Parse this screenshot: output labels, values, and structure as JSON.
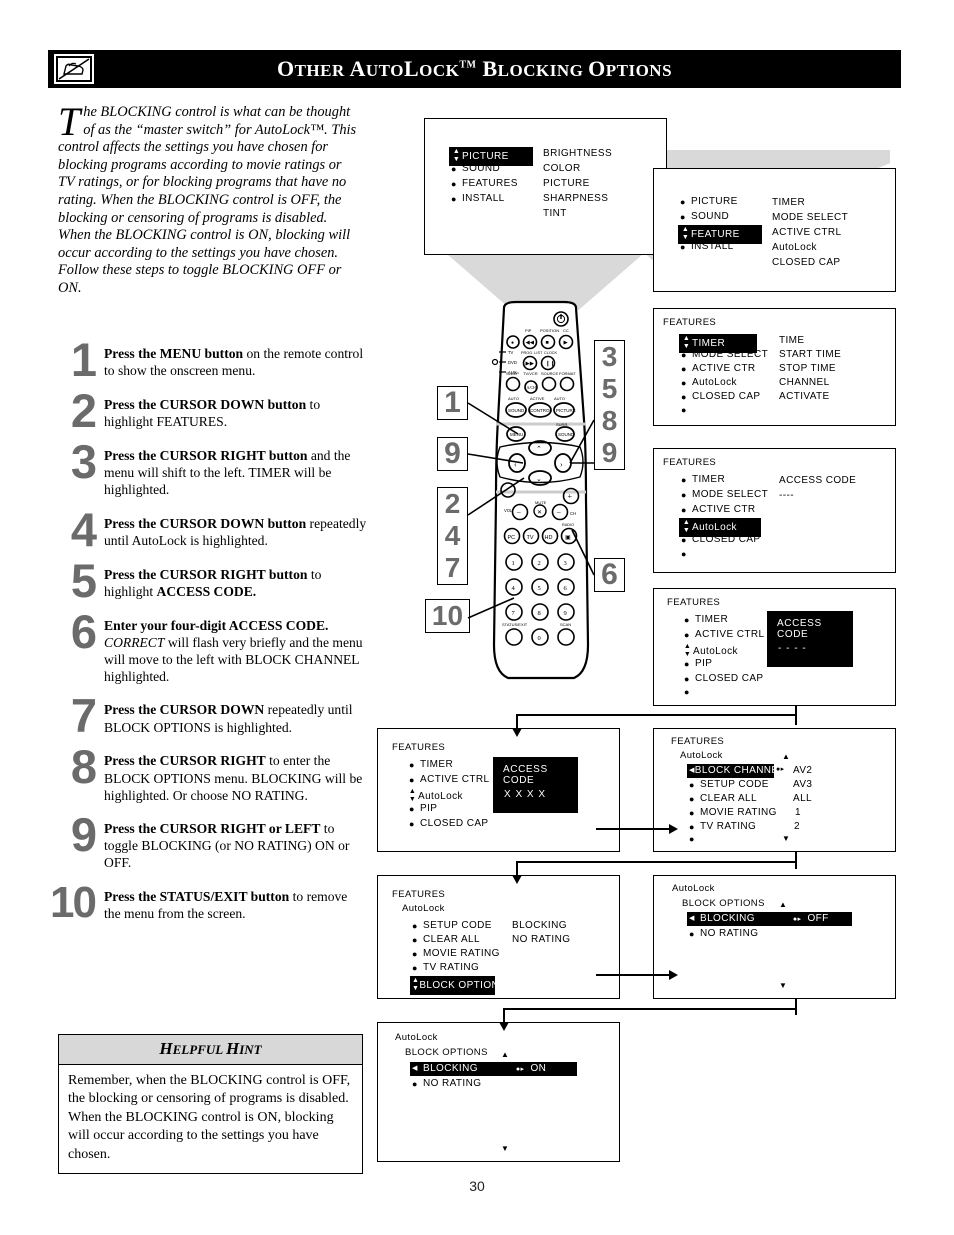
{
  "header": {
    "icon": "hand-pointing-tv-icon",
    "title_parts": [
      "O",
      "THER ",
      "A",
      "UTO",
      "L",
      "OCK",
      "TM",
      " B",
      "LOCKING ",
      "O",
      "PTIONS"
    ],
    "title_plain": "Other AutoLock™ Blocking Options"
  },
  "intro": {
    "dropcap": "T",
    "text": "he BLOCKING control is what can be thought of as the “master switch” for AutoLock™. This control affects the settings you have chosen for blocking programs according to movie ratings or TV ratings, or for blocking programs that have no rating. When the BLOCKING control is OFF, the blocking or censoring of programs is disabled. When the BLOCKING control is ON, blocking will occur according to the settings you have chosen. Follow these steps to toggle BLOCKING OFF or ON."
  },
  "steps": [
    {
      "num": "1",
      "bold": "Press the MENU button",
      "rest": " on the remote control to show the onscreen menu."
    },
    {
      "num": "2",
      "bold": "Press the CURSOR DOWN button",
      "rest": " to highlight FEATURES."
    },
    {
      "num": "3",
      "bold": "Press the CURSOR RIGHT button",
      "rest": " and the menu will shift to the left. TIMER will be highlighted."
    },
    {
      "num": "4",
      "bold": "Press the CURSOR DOWN button",
      "rest": " repeatedly until AutoLock is highlighted."
    },
    {
      "num": "5",
      "bold": "Press the CURSOR RIGHT button",
      "rest": " to highlight ",
      "bold2": "ACCESS CODE."
    },
    {
      "num": "6",
      "bold": "Enter your four-digit ACCESS CODE.",
      "italic": " CORRECT",
      "rest": " will flash very briefly and the menu will move to the left with BLOCK CHANNEL highlighted."
    },
    {
      "num": "7",
      "bold": "Press the CURSOR DOWN",
      "rest": " repeatedly until BLOCK OPTIONS is highlighted."
    },
    {
      "num": "8",
      "bold": "Press the CURSOR RIGHT",
      "rest": " to enter the BLOCK OPTIONS menu. BLOCKING will be highlighted. Or choose NO RATING."
    },
    {
      "num": "9",
      "bold": "Press the CURSOR RIGHT or LEFT",
      "rest": " to toggle BLOCKING (or NO RATING) ON or OFF."
    },
    {
      "num": "10",
      "bold": "Press the STATUS/EXIT button",
      "rest": " to remove the menu from the screen."
    }
  ],
  "hint": {
    "title_first": "H",
    "title_rest1": "ELPFUL ",
    "title_second": "H",
    "title_rest2": "INT",
    "title_plain": "HELPFUL HINT",
    "body": "Remember, when the BLOCKING control is OFF, the blocking or censoring of programs is disabled. When the BLOCKING control is ON, blocking will occur according to the settings you have chosen."
  },
  "page_number": "30",
  "remote": {
    "callouts": [
      "1",
      "9",
      "2",
      "4",
      "7",
      "10",
      "3",
      "5",
      "8",
      "9",
      "6"
    ],
    "callout_left_a": "1",
    "callout_left_b": "9",
    "callout_left_c": [
      "2",
      "4",
      "7"
    ],
    "callout_left_d": "10",
    "callout_right_a": [
      "3",
      "5",
      "8",
      "9"
    ],
    "callout_right_b": "6"
  },
  "osd_screens": [
    {
      "id": "screen1",
      "title": "",
      "left_items": [
        {
          "label": "PICTURE",
          "highlighted": true,
          "marker": "updown"
        },
        {
          "label": "SOUND",
          "highlighted": false,
          "marker": "bullet"
        },
        {
          "label": "FEATURES",
          "highlighted": false,
          "marker": "bullet"
        },
        {
          "label": "INSTALL",
          "highlighted": false,
          "marker": "bullet"
        }
      ],
      "right_items": [
        "BRIGHTNESS",
        "COLOR",
        "PICTURE",
        "SHARPNESS",
        "TINT"
      ]
    },
    {
      "id": "screen2",
      "title": "",
      "left_items": [
        {
          "label": "PICTURE",
          "highlighted": false,
          "marker": "bullet"
        },
        {
          "label": "SOUND",
          "highlighted": false,
          "marker": "bullet"
        },
        {
          "label": "FEATURE",
          "highlighted": true,
          "marker": "updown"
        },
        {
          "label": "INSTALL",
          "highlighted": false,
          "marker": "bullet"
        }
      ],
      "right_items": [
        "TIMER",
        "MODE SELECT",
        "ACTIVE CTRL",
        "AutoLock",
        "CLOSED CAP"
      ]
    },
    {
      "id": "screen3",
      "title": "FEATURES",
      "left_items": [
        {
          "label": "TIMER",
          "highlighted": true,
          "marker": "updown"
        },
        {
          "label": "MODE SELECT",
          "highlighted": false,
          "marker": "bullet"
        },
        {
          "label": "ACTIVE CTR",
          "highlighted": false,
          "marker": "bullet"
        },
        {
          "label": "AutoLock",
          "highlighted": false,
          "marker": "bullet"
        },
        {
          "label": "CLOSED CAP",
          "highlighted": false,
          "marker": "bullet"
        },
        {
          "label": "",
          "highlighted": false,
          "marker": "bullet"
        }
      ],
      "right_items": [
        "TIME",
        "START TIME",
        "STOP TIME",
        "CHANNEL",
        "ACTIVATE"
      ]
    },
    {
      "id": "screen4",
      "title": "FEATURES",
      "left_items": [
        {
          "label": "TIMER",
          "highlighted": false,
          "marker": "bullet"
        },
        {
          "label": "MODE SELECT",
          "highlighted": false,
          "marker": "bullet"
        },
        {
          "label": "ACTIVE CTR",
          "highlighted": false,
          "marker": "bullet"
        },
        {
          "label": "AutoLock",
          "highlighted": true,
          "marker": "updown"
        },
        {
          "label": "CLOSED CAP",
          "highlighted": false,
          "marker": "bullet"
        },
        {
          "label": "",
          "highlighted": false,
          "marker": "bullet"
        }
      ],
      "right_items": [
        "ACCESS CODE",
        "----"
      ]
    },
    {
      "id": "screen5",
      "title": "FEATURES",
      "left_items": [
        {
          "label": "TIMER",
          "highlighted": false,
          "marker": "bullet"
        },
        {
          "label": "ACTIVE CTRL",
          "highlighted": false,
          "marker": "bullet"
        },
        {
          "label": "AutoLock",
          "highlighted": false,
          "marker": "updown"
        },
        {
          "label": "PIP",
          "highlighted": false,
          "marker": "bullet"
        },
        {
          "label": "CLOSED CAP",
          "highlighted": false,
          "marker": "bullet"
        },
        {
          "label": "",
          "highlighted": false,
          "marker": "bullet"
        }
      ],
      "black_box": {
        "line1": "ACCESS CODE",
        "line2": "- - - -"
      }
    },
    {
      "id": "screen6",
      "title": "FEATURES",
      "left_items": [
        {
          "label": "TIMER",
          "highlighted": false,
          "marker": "bullet"
        },
        {
          "label": "ACTIVE CTRL",
          "highlighted": false,
          "marker": "bullet"
        },
        {
          "label": "AutoLock",
          "highlighted": false,
          "marker": "updown"
        },
        {
          "label": "PIP",
          "highlighted": false,
          "marker": "bullet"
        },
        {
          "label": "CLOSED CAP",
          "highlighted": false,
          "marker": "bullet"
        }
      ],
      "black_box": {
        "line1": "ACCESS CODE",
        "line2": "X X X X"
      }
    },
    {
      "id": "screen7",
      "title": "FEATURES",
      "subtitle": "AutoLock",
      "left_items": [
        {
          "label": "BLOCK CHANNEL",
          "highlighted": true,
          "marker": "left"
        },
        {
          "label": "SETUP CODE",
          "highlighted": false,
          "marker": "bullet"
        },
        {
          "label": "CLEAR ALL",
          "highlighted": false,
          "marker": "bullet"
        },
        {
          "label": "MOVIE RATING",
          "highlighted": false,
          "marker": "bullet"
        },
        {
          "label": "TV RATING",
          "highlighted": false,
          "marker": "bullet"
        },
        {
          "label": "",
          "highlighted": false,
          "marker": "bullet"
        }
      ],
      "right_items": [
        "AV2",
        "AV3",
        "ALL",
        "1",
        "2"
      ],
      "scroll_up": "▲",
      "scroll_down": "▼"
    },
    {
      "id": "screen8",
      "title": "FEATURES",
      "subtitle": "AutoLock",
      "left_items": [
        {
          "label": "SETUP CODE",
          "highlighted": false,
          "marker": "bullet"
        },
        {
          "label": "CLEAR ALL",
          "highlighted": false,
          "marker": "bullet"
        },
        {
          "label": "MOVIE RATING",
          "highlighted": false,
          "marker": "bullet"
        },
        {
          "label": "TV RATING",
          "highlighted": false,
          "marker": "bullet"
        },
        {
          "label": "BLOCK OPTIONS",
          "highlighted": true,
          "marker": "updown"
        }
      ],
      "right_items": [
        "BLOCKING",
        "NO RATING"
      ]
    },
    {
      "id": "screen9",
      "title": "AutoLock",
      "subtitle": "BLOCK OPTIONS",
      "left_items": [
        {
          "label": "BLOCKING",
          "highlighted": true,
          "marker": "left",
          "value": "OFF"
        },
        {
          "label": "NO RATING",
          "highlighted": false,
          "marker": "bullet"
        }
      ],
      "scroll_up": "▲",
      "scroll_down": "▼"
    },
    {
      "id": "screen10",
      "title": "AutoLock",
      "subtitle": "BLOCK OPTIONS",
      "left_items": [
        {
          "label": "BLOCKING",
          "highlighted": true,
          "marker": "left",
          "value": "ON"
        },
        {
          "label": "NO RATING",
          "highlighted": false,
          "marker": "bullet"
        }
      ],
      "scroll_up": "▲",
      "scroll_down": "▼"
    }
  ]
}
